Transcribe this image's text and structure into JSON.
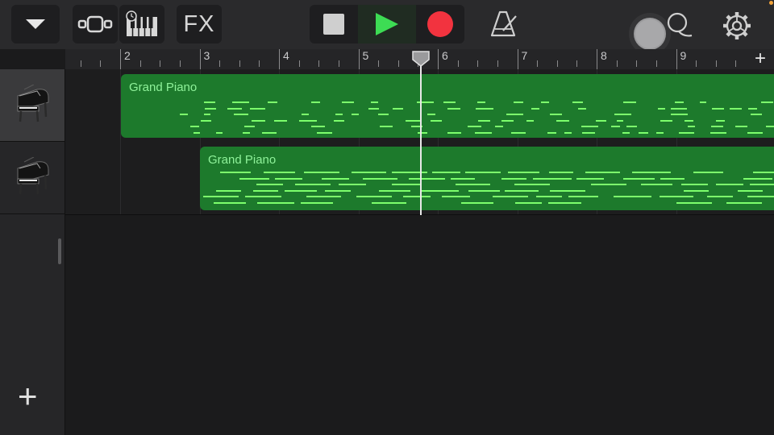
{
  "toolbar": {
    "fx_label": "FX",
    "icons": {
      "menu": "chevron-down-icon",
      "tracks_view": "tracks-view-icon",
      "keyboard": "keyboard-icon",
      "stop": "stop-icon",
      "play": "play-icon",
      "record": "record-icon",
      "metronome": "metronome-icon",
      "volume": "master-volume-knob",
      "settings": "gear-icon"
    },
    "colors": {
      "play": "#3ddc54",
      "record": "#f2333f"
    }
  },
  "ruler": {
    "bars": [
      "2",
      "3",
      "4",
      "5",
      "6",
      "7",
      "8",
      "9"
    ],
    "add_label": "+"
  },
  "tracks": [
    {
      "instrument": "Grand Piano",
      "region_label": "Grand Piano",
      "selected": true
    },
    {
      "instrument": "Grand Piano",
      "region_label": "Grand Piano",
      "selected": false
    }
  ],
  "sidebar": {
    "add_track_label": "+"
  },
  "colors": {
    "region": "#1d7a2c",
    "note": "#7dff6c",
    "region_text": "#8ff29a"
  }
}
